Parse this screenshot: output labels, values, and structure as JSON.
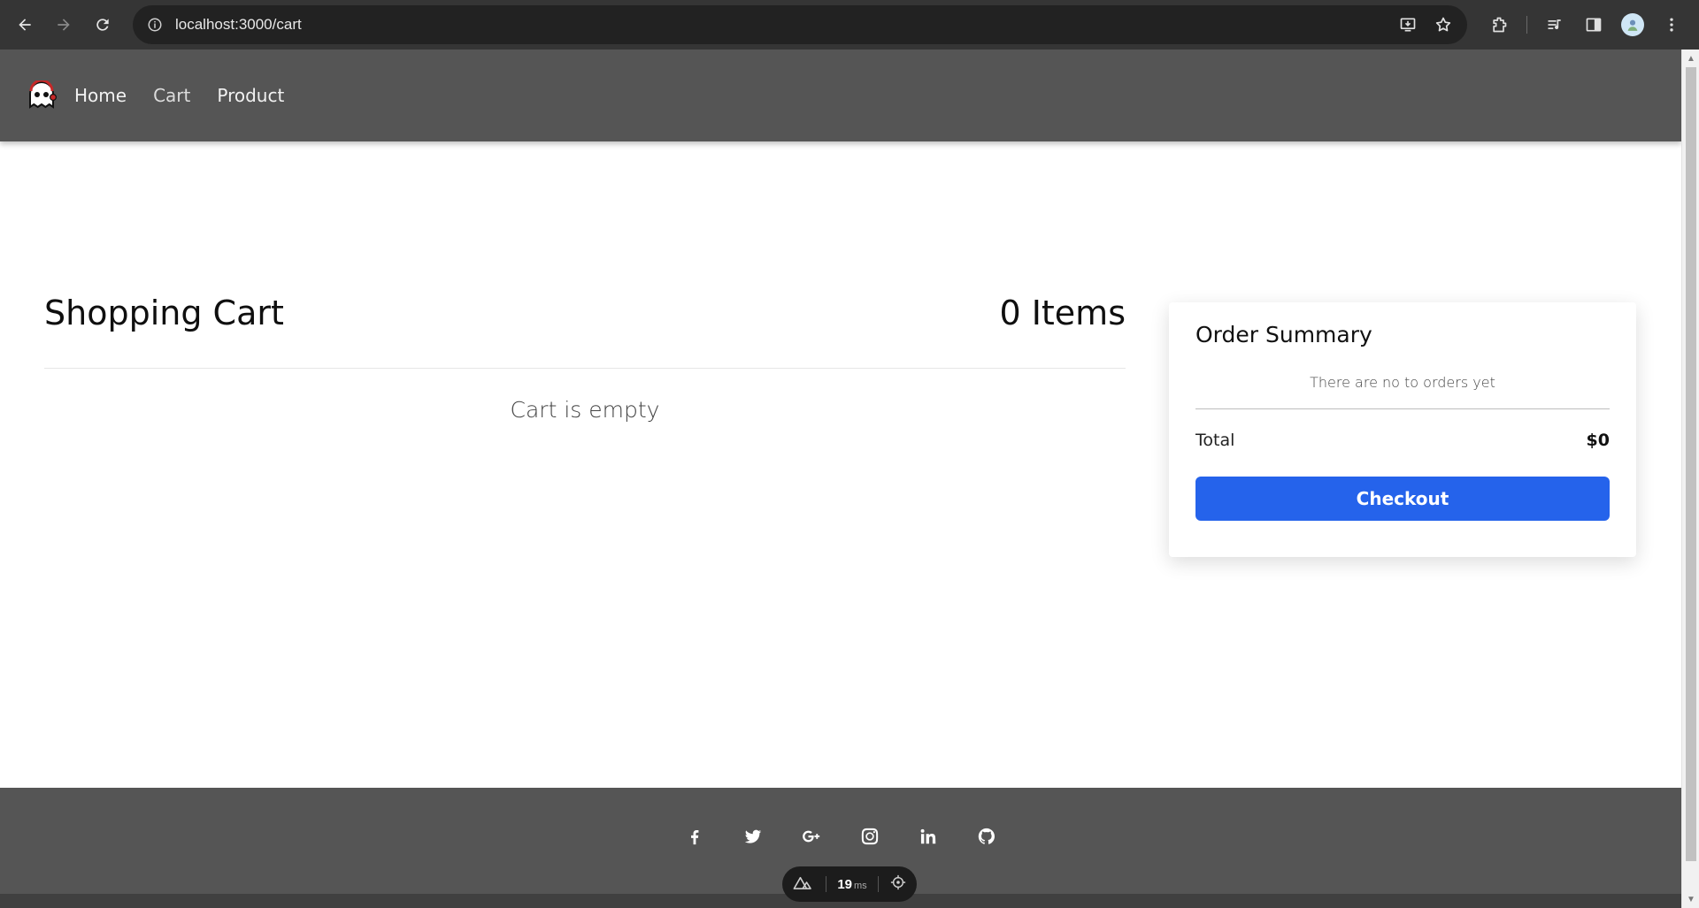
{
  "browser": {
    "url": "localhost:3000/cart"
  },
  "header": {
    "nav": [
      {
        "label": "Home"
      },
      {
        "label": "Cart"
      },
      {
        "label": "Product"
      }
    ]
  },
  "cart": {
    "title": "Shopping Cart",
    "count_label": "0 Items",
    "empty_message": "Cart is empty"
  },
  "summary": {
    "title": "Order Summary",
    "empty_message": "There are no to orders yet",
    "total_label": "Total",
    "total_value": "$0",
    "checkout_label": "Checkout",
    "accent_color": "#2563eb"
  },
  "footer": {
    "social_icons": [
      "facebook-icon",
      "twitter-icon",
      "google-plus-icon",
      "instagram-icon",
      "linkedin-icon",
      "github-icon"
    ],
    "background_color": "#555555"
  },
  "dev_pill": {
    "ms_value": "19",
    "ms_unit": "ms"
  }
}
